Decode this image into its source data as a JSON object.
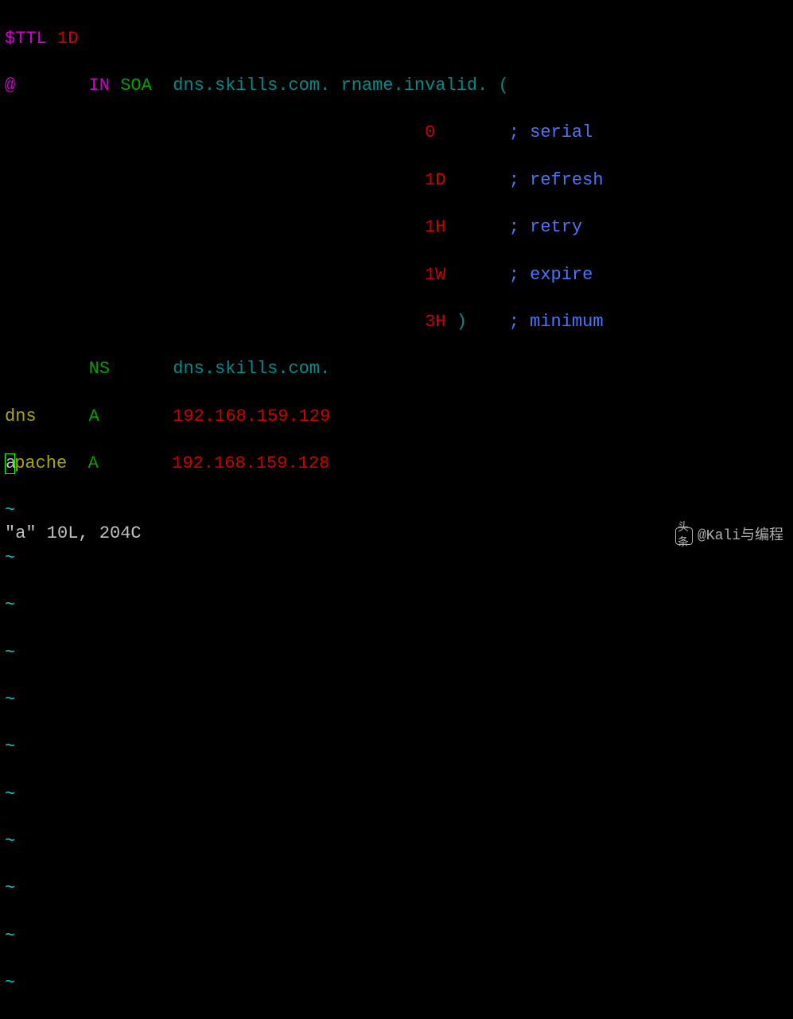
{
  "zone": {
    "ttl_directive": "$TTL",
    "ttl_value": "1D",
    "origin_at": "@",
    "class_in": "IN",
    "type_soa": "SOA",
    "soa_primary": "dns.skills.com.",
    "soa_rname": "rname.invalid.",
    "soa_open": "(",
    "soa_close": ")",
    "soa_params": [
      {
        "value": "0",
        "comment_prefix": ";",
        "comment_text": "serial"
      },
      {
        "value": "1D",
        "comment_prefix": ";",
        "comment_text": "refresh"
      },
      {
        "value": "1H",
        "comment_prefix": ";",
        "comment_text": "retry"
      },
      {
        "value": "1W",
        "comment_prefix": ";",
        "comment_text": "expire"
      },
      {
        "value": "3H",
        "comment_prefix": ";",
        "comment_text": "minimum"
      }
    ],
    "ns": {
      "type": "NS",
      "target": "dns.skills.com."
    },
    "a_records": [
      {
        "name": "dns",
        "type": "A",
        "ip": "192.168.159.129"
      },
      {
        "name_first": "a",
        "name_rest": "pache",
        "type": "A",
        "ip": "192.168.159.128"
      }
    ]
  },
  "tilde": "~",
  "status": {
    "text": "\"a\" 10L, 204C"
  },
  "watermark": {
    "icon": "头条",
    "text": "@Kali与编程"
  }
}
